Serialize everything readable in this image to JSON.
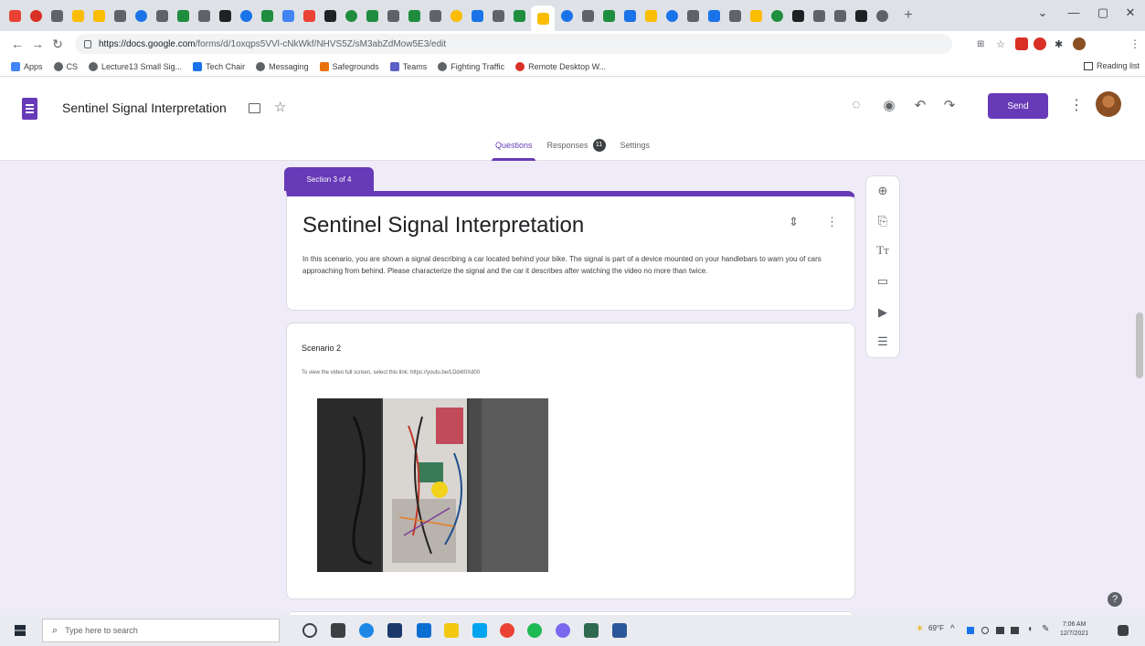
{
  "browser": {
    "url_host": "https://docs.google.com",
    "url_path": "/forms/d/1oxqps5VVl-cNkWkf/NHVS5Z/sM3abZdMow5E3/edit",
    "bookmarks": [
      "Apps",
      "CS",
      "Lecture13 Small Sig...",
      "Tech Chair",
      "Messaging",
      "Safegrounds",
      "Teams",
      "Fighting Traffic",
      "Remote Desktop W..."
    ],
    "reading_list": "Reading list",
    "colors": {
      "tab_favicons": [
        "#ea4335",
        "#d93025",
        "#5f6368",
        "#fbbc04",
        "#fbbc04",
        "#5f6368",
        "#1a73e8",
        "#5f6368",
        "#1e8e3e",
        "#5f6368",
        "#202124",
        "#1a73e8",
        "#1e8e3e",
        "#4285f4",
        "#ea4335",
        "#202124",
        "#1e8e3e",
        "#1e8e3e",
        "#5f6368",
        "#1e8e3e",
        "#5f6368",
        "#fbbc04",
        "#1a73e8",
        "#5f6368",
        "#1e8e3e",
        "#fbbc04",
        "#1a73e8",
        "#5f6368",
        "#1e8e3e",
        "#1a73e8",
        "#fbbc04",
        "#1a73e8",
        "#5f6368",
        "#1a73e8",
        "#5f6368",
        "#fbbc04",
        "#1e8e3e",
        "#202124",
        "#5f6368",
        "#5f6368",
        "#202124",
        "#5f6368"
      ]
    }
  },
  "header": {
    "doc_title": "Sentinel Signal Interpretation",
    "send_label": "Send",
    "tabs": {
      "questions": "Questions",
      "responses": "Responses",
      "responses_count": "11",
      "settings": "Settings"
    }
  },
  "section": {
    "tab_label": "Section 3 of 4",
    "title": "Sentinel Signal Interpretation",
    "description": "In this scenario, you are shown a signal describing a car located behind your bike. The signal is part of a device mounted on your handlebars to warn you of cars approaching from behind. Please characterize the signal and the car it describes after watching the video no more than twice."
  },
  "question": {
    "title": "Scenario 2",
    "link_text": "To view the video full screen, select this link: https://youtu.be/LDd4t0Xd00"
  },
  "taskbar": {
    "search_placeholder": "Type here to search",
    "weather": "69°F",
    "time": "7:06 AM",
    "date": "12/7/2021"
  },
  "theme": {
    "accent": "#673ab7",
    "background": "#f0ebf8"
  }
}
